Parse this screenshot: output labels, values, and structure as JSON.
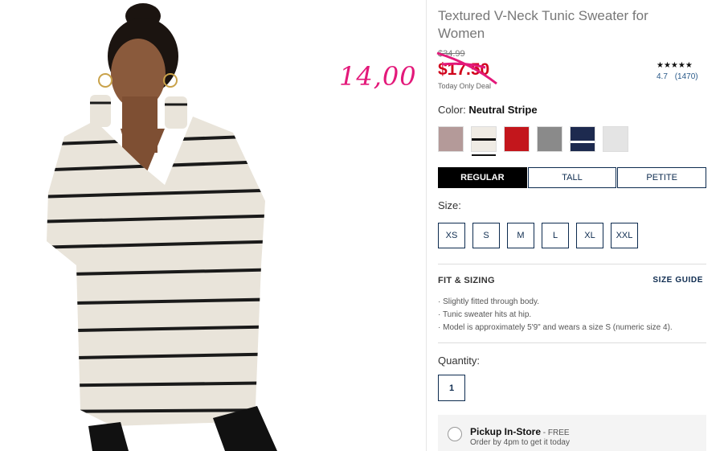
{
  "product": {
    "title": "Textured V-Neck Tunic Sweater for Women",
    "price_original": "$34.99",
    "price_sale": "$17.50",
    "deal_text": "Today Only Deal",
    "rating_stars": "★★★★★",
    "rating_value": "4.7",
    "rating_count": "(1470)"
  },
  "annotation": "14,00",
  "color": {
    "label": "Color:",
    "selected_name": "Neutral Stripe",
    "swatches": [
      {
        "name": "rose-heather",
        "hex": "#b49a99"
      },
      {
        "name": "neutral-stripe",
        "hex": "#efebe4",
        "selected": true
      },
      {
        "name": "red",
        "hex": "#c3161c"
      },
      {
        "name": "heather-gray",
        "hex": "#8a8a8a"
      },
      {
        "name": "navy-stripe",
        "hex": "#1d2a4f"
      },
      {
        "name": "light-gray",
        "hex": "#e4e4e4"
      }
    ]
  },
  "fits": [
    {
      "label": "REGULAR",
      "active": true
    },
    {
      "label": "TALL",
      "active": false
    },
    {
      "label": "PETITE",
      "active": false
    }
  ],
  "size": {
    "label": "Size:",
    "options": [
      "XS",
      "S",
      "M",
      "L",
      "XL",
      "XXL"
    ]
  },
  "fit_sizing": {
    "title": "FIT & SIZING",
    "guide_link": "SIZE GUIDE",
    "bullets": [
      "Slightly fitted through body.",
      "Tunic sweater hits at hip.",
      "Model is approximately 5'9\" and wears a size S (numeric size 4)."
    ]
  },
  "quantity": {
    "label": "Quantity:",
    "value": "1"
  },
  "pickup": {
    "title": "Pickup In-Store",
    "free": " - FREE",
    "subtitle": "Order by 4pm to get it today"
  },
  "colors": {
    "sale_red": "#d0021b",
    "navy": "#0d2b4f",
    "annotation_pink": "#e3197a"
  }
}
